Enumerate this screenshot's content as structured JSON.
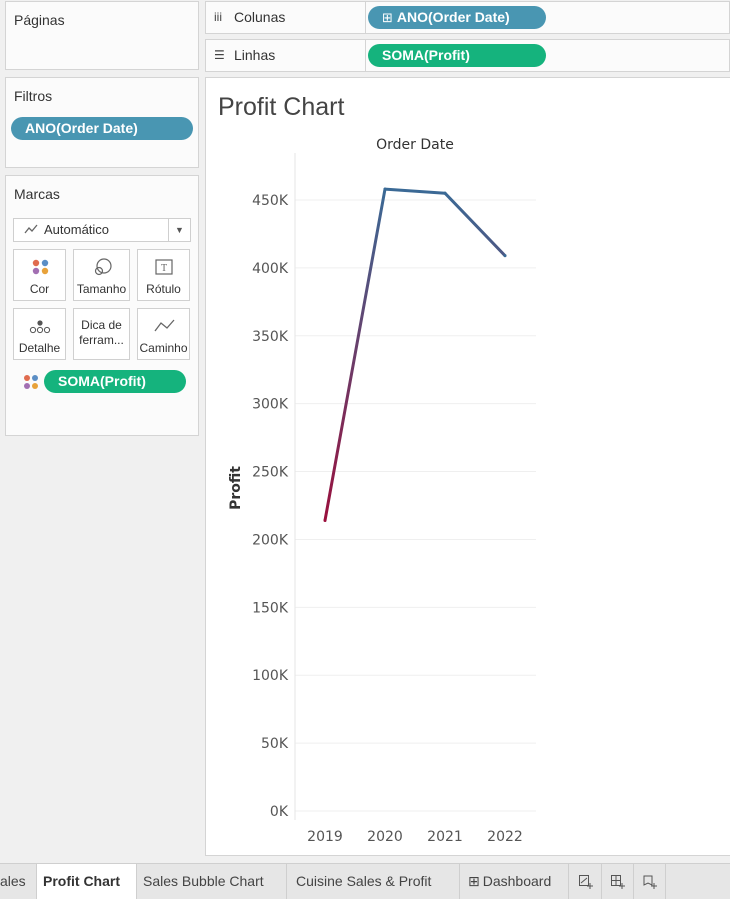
{
  "shelves": {
    "pages_label": "Páginas",
    "columns_label": "Colunas",
    "columns_pill": "ANO(Order Date)",
    "rows_label": "Linhas",
    "rows_pill": "SOMA(Profit)"
  },
  "filters": {
    "title": "Filtros",
    "pill": "ANO(Order Date)"
  },
  "marks": {
    "title": "Marcas",
    "type_selected": "Automático",
    "buttons": [
      "Cor",
      "Tamanho",
      "Rótulo",
      "Detalhe",
      "Dica de ferram...",
      "Caminho"
    ],
    "color_pill": "SOMA(Profit)"
  },
  "sheet_title": "Profit Chart",
  "chart_data": {
    "type": "line",
    "title": "Order Date",
    "xlabel": "",
    "ylabel": "Profit",
    "categories": [
      "2019",
      "2020",
      "2021",
      "2022"
    ],
    "values": [
      214000,
      458000,
      455000,
      409000
    ],
    "ylim": [
      0,
      450000
    ],
    "yticks": [
      "0K",
      "50K",
      "100K",
      "150K",
      "200K",
      "250K",
      "300K",
      "350K",
      "400K",
      "450K"
    ],
    "color_low": "#9b0f3c",
    "color_high": "#3a6a96",
    "grid": true
  },
  "tabs": {
    "items": [
      "ales",
      "Profit Chart",
      "Sales Bubble Chart",
      "Cuisine Sales & Profit",
      "Dashboard"
    ],
    "active": "Profit Chart"
  },
  "colors": {
    "pill_blue": "#4996b2",
    "pill_green": "#15b37d"
  }
}
